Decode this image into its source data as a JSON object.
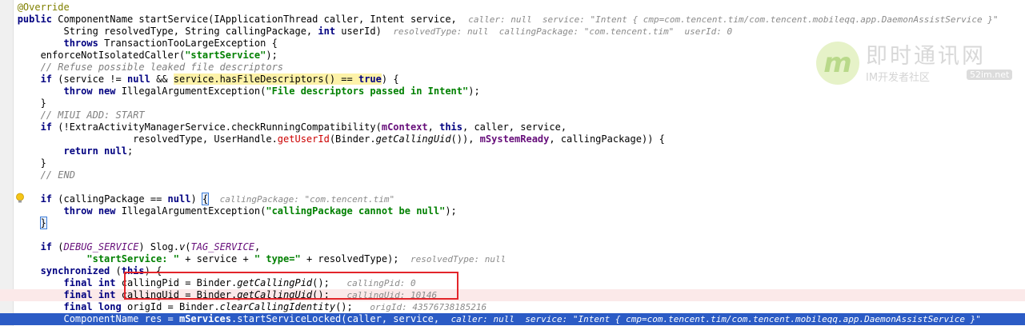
{
  "lines": [
    {
      "indent": "   ",
      "segs": [
        [
          "ann",
          "@Override"
        ]
      ]
    },
    {
      "indent": "   ",
      "segs": [
        [
          "k",
          "public "
        ],
        [
          "",
          "ComponentName startService(IApplicationThread caller, Intent service,  "
        ],
        [
          "hint",
          "caller: null  service: \"Intent { cmp=com.tencent.tim/com.tencent.mobileqq.app.DaemonAssistService }\""
        ]
      ]
    },
    {
      "indent": "           ",
      "segs": [
        [
          "",
          "String resolvedType, String callingPackage, "
        ],
        [
          "k",
          "int "
        ],
        [
          "",
          "userId)  "
        ],
        [
          "hint",
          "resolvedType: null  callingPackage: \"com.tencent.tim\"  userId: 0"
        ]
      ]
    },
    {
      "indent": "           ",
      "segs": [
        [
          "k",
          "throws "
        ],
        [
          "",
          "TransactionTooLargeException {"
        ]
      ]
    },
    {
      "indent": "       ",
      "segs": [
        [
          "",
          "enforceNotIsolatedCaller("
        ],
        [
          "str",
          "\"startService\""
        ],
        [
          "",
          ");"
        ]
      ]
    },
    {
      "indent": "       ",
      "segs": [
        [
          "c",
          "// Refuse possible leaked file descriptors"
        ]
      ]
    },
    {
      "indent": "       ",
      "segs": [
        [
          "k",
          "if "
        ],
        [
          "",
          "(service != "
        ],
        [
          "k",
          "null "
        ],
        [
          "",
          "&& "
        ],
        [
          "hl",
          "service.hasFileDescriptors() == "
        ],
        [
          "hlk",
          "true"
        ],
        [
          "",
          ") {"
        ]
      ]
    },
    {
      "indent": "           ",
      "segs": [
        [
          "k",
          "throw new "
        ],
        [
          "",
          "IllegalArgumentException("
        ],
        [
          "str",
          "\"File descriptors passed in Intent\""
        ],
        [
          "",
          ");"
        ]
      ]
    },
    {
      "indent": "       ",
      "segs": [
        [
          "",
          "}"
        ]
      ]
    },
    {
      "indent": "       ",
      "segs": [
        [
          "c",
          "// MIUI ADD: START"
        ]
      ]
    },
    {
      "indent": "       ",
      "segs": [
        [
          "k",
          "if "
        ],
        [
          "",
          "(!ExtraActivityManagerService.checkRunningCompatibility("
        ],
        [
          "fld",
          "mContext"
        ],
        [
          "",
          ", "
        ],
        [
          "k",
          "this"
        ],
        [
          "",
          ", caller, service,"
        ]
      ]
    },
    {
      "indent": "                       ",
      "segs": [
        [
          "",
          "resolvedType, UserHandle."
        ],
        [
          "red",
          "getUserId"
        ],
        [
          "",
          "(Binder."
        ],
        [
          "it",
          "getCallingUid"
        ],
        [
          "",
          "()), "
        ],
        [
          "fld",
          "mSystemReady"
        ],
        [
          "",
          ", callingPackage)) {"
        ]
      ]
    },
    {
      "indent": "           ",
      "segs": [
        [
          "k",
          "return null"
        ],
        [
          "",
          ";"
        ]
      ]
    },
    {
      "indent": "       ",
      "segs": [
        [
          "",
          "}"
        ]
      ]
    },
    {
      "indent": "       ",
      "segs": [
        [
          "c",
          "// END"
        ]
      ]
    },
    {
      "indent": "",
      "segs": []
    },
    {
      "indent": "       ",
      "segs": [
        [
          "k",
          "if "
        ],
        [
          "",
          "(callingPackage == "
        ],
        [
          "k",
          "null"
        ],
        [
          "",
          ") "
        ],
        [
          "br",
          "{"
        ],
        [
          "",
          "  "
        ],
        [
          "hint",
          "callingPackage: \"com.tencent.tim\""
        ]
      ]
    },
    {
      "indent": "           ",
      "segs": [
        [
          "k",
          "throw new "
        ],
        [
          "",
          "IllegalArgumentException("
        ],
        [
          "str",
          "\"callingPackage cannot be null\""
        ],
        [
          "",
          ");"
        ]
      ]
    },
    {
      "indent": "       ",
      "segs": [
        [
          "br",
          "}"
        ]
      ]
    },
    {
      "indent": "",
      "segs": []
    },
    {
      "indent": "       ",
      "segs": [
        [
          "k",
          "if "
        ],
        [
          "",
          "("
        ],
        [
          "sc",
          "DEBUG_SERVICE"
        ],
        [
          "",
          ") Slog."
        ],
        [
          "it",
          "v"
        ],
        [
          "",
          "("
        ],
        [
          "sc",
          "TAG_SERVICE"
        ],
        [
          "",
          ","
        ]
      ]
    },
    {
      "indent": "               ",
      "segs": [
        [
          "str",
          "\"startService: \" "
        ],
        [
          "",
          "+ service + "
        ],
        [
          "str",
          "\" type=\" "
        ],
        [
          "",
          "+ resolvedType);  "
        ],
        [
          "hint",
          "resolvedType: null"
        ]
      ]
    },
    {
      "indent": "       ",
      "segs": [
        [
          "k",
          "synchronized "
        ],
        [
          "",
          "("
        ],
        [
          "k",
          "this"
        ],
        [
          "",
          ") {"
        ]
      ]
    },
    {
      "indent": "           ",
      "segs": [
        [
          "k",
          "final int "
        ],
        [
          "",
          "callingPid = Binder."
        ],
        [
          "it",
          "getCallingPid"
        ],
        [
          "",
          "();   "
        ],
        [
          "hint",
          "callingPid: 0"
        ]
      ]
    },
    {
      "indent": "           ",
      "cls": "err",
      "segs": [
        [
          "k",
          "final int "
        ],
        [
          "",
          "callingUid = Binder."
        ],
        [
          "it",
          "getCallingUid"
        ],
        [
          "",
          "();   "
        ],
        [
          "hint",
          "callingUid: 10146"
        ]
      ]
    },
    {
      "indent": "           ",
      "segs": [
        [
          "k",
          "final long "
        ],
        [
          "",
          "origId = Binder."
        ],
        [
          "it",
          "clearCallingIdentity"
        ],
        [
          "",
          "();   "
        ],
        [
          "hint",
          "origId: 43576738185216"
        ]
      ]
    },
    {
      "indent": "           ",
      "cls": "cur",
      "segs": [
        [
          "",
          "ComponentName res = "
        ],
        [
          "fld",
          "mServices"
        ],
        [
          "",
          ".startServiceLocked(caller, service,  "
        ],
        [
          "hint",
          "caller: null  service: \"Intent { cmp=com.tencent.tim/com.tencent.mobileqq.app.DaemonAssistService }\""
        ]
      ]
    }
  ],
  "watermark": {
    "logo_letter": "m",
    "title": "即时通讯网",
    "subtitle": "IM开发者社区",
    "badge": "52im.net"
  },
  "colors": {
    "accent_box": "#e3252a",
    "current_line": "#2b5bc5",
    "error_line": "#fbe9e9"
  },
  "icons": {
    "gutter_hint": "lightbulb-icon"
  }
}
